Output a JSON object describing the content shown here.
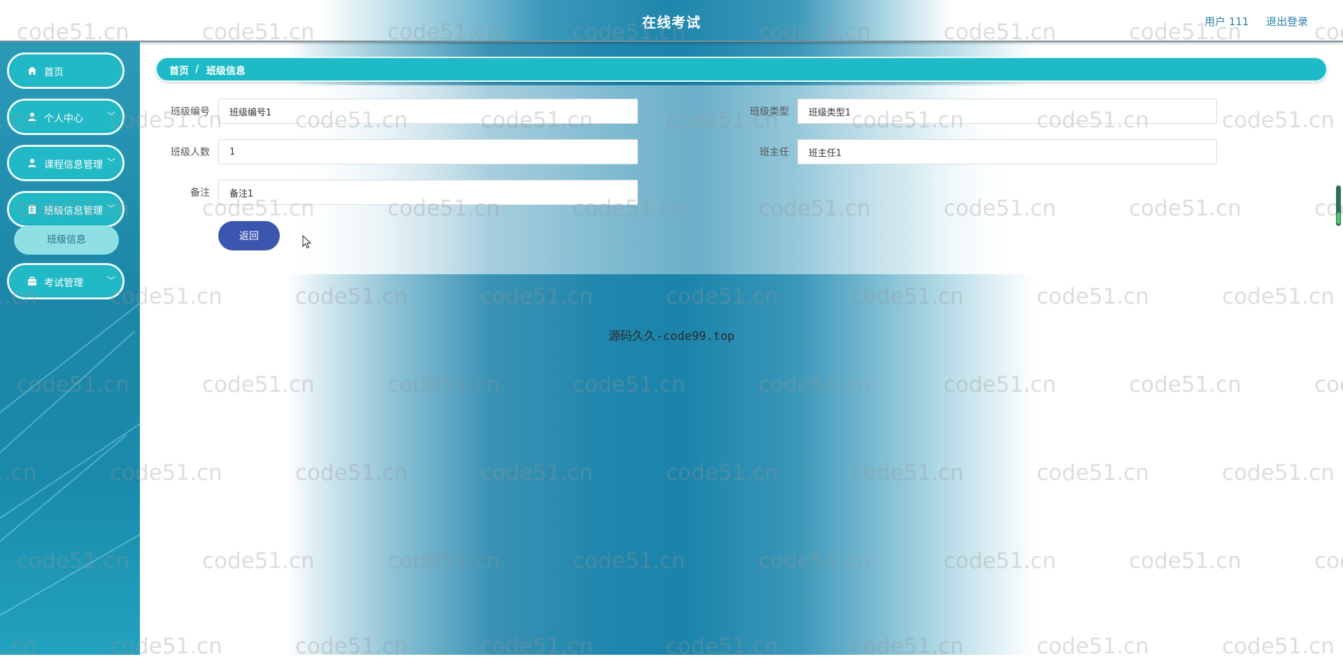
{
  "header": {
    "title": "在线考试",
    "user": "用户 111",
    "logout": "退出登录"
  },
  "sidebar": {
    "items": [
      {
        "label": "首页",
        "icon": "home-icon",
        "has_submenu": false
      },
      {
        "label": "个人中心",
        "icon": "user-icon",
        "has_submenu": true
      },
      {
        "label": "课程信息管理",
        "icon": "user-icon",
        "has_submenu": true
      },
      {
        "label": "班级信息管理",
        "icon": "clipboard-icon",
        "has_submenu": true
      },
      {
        "label": "考试管理",
        "icon": "briefcase-icon",
        "has_submenu": true
      }
    ],
    "submenu": {
      "label": "班级信息"
    }
  },
  "breadcrumb": {
    "home": "首页",
    "separator": "/",
    "current": "班级信息"
  },
  "form": {
    "class_no_label": "班级编号",
    "class_no_value": "班级编号1",
    "class_type_label": "班级类型",
    "class_type_value": "班级类型1",
    "class_size_label": "班级人数",
    "class_size_value": "1",
    "head_teacher_label": "班主任",
    "head_teacher_value": "班主任1",
    "remark_label": "备注",
    "remark_value": "备注1",
    "back_button": "返回"
  },
  "footer": {
    "text": "源码久久-code99.top"
  },
  "watermark": {
    "text": "code51.cn"
  },
  "colors": {
    "accent": "#1fbac7",
    "button": "#3c56b0",
    "header_text": "#2a80a8"
  }
}
